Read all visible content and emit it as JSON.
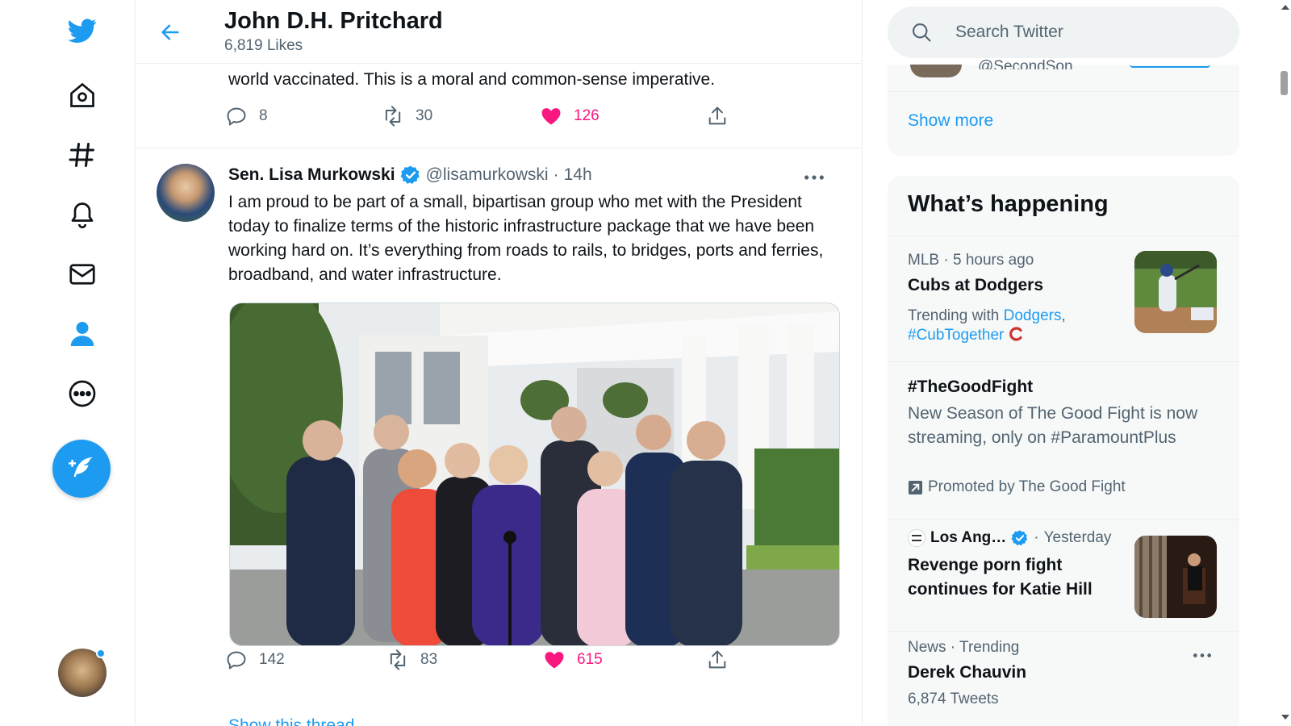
{
  "profile": {
    "title": "John D.H. Pritchard",
    "subtitle": "6,819 Likes"
  },
  "tweet1": {
    "text_tail": "world vaccinated. This is a moral and common-sense imperative.",
    "replies": "8",
    "retweets": "30",
    "likes": "126"
  },
  "tweet2": {
    "name": "Sen. Lisa Murkowski",
    "handle": "@lisamurkowski",
    "separator": "·",
    "time": "14h",
    "text": "I am proud to be part of a small, bipartisan group who met with the President today to finalize terms of the historic infrastructure package that we have been working hard on. It’s everything from roads to rails, to bridges, ports and ferries, broadband, and water infrastructure.",
    "replies": "142",
    "retweets": "83",
    "likes": "615",
    "show_thread": "Show this thread"
  },
  "search": {
    "placeholder": "Search Twitter"
  },
  "who_to_follow": {
    "partial_handle": "@SecondSon",
    "show_more": "Show more"
  },
  "trends": {
    "title": "What’s happening",
    "items": [
      {
        "meta_category": "MLB",
        "meta_sep": "·",
        "meta_time": "5 hours ago",
        "title": "Cubs at Dodgers",
        "trending_with_label": "Trending with",
        "link1": "Dodgers",
        "comma": ",",
        "link2": "#CubTogether"
      },
      {
        "title": "#TheGoodFight",
        "description": "New Season of The Good Fight is now streaming, only on #ParamountPlus",
        "promoted": "Promoted by The Good Fight"
      },
      {
        "source": "Los Ang…",
        "meta_sep": "·",
        "meta_time": "Yesterday",
        "title": "Revenge porn fight continues for Katie Hill"
      },
      {
        "meta": "News · Trending",
        "title": "Derek Chauvin",
        "count": "6,874 Tweets"
      }
    ]
  },
  "icons": {
    "nav": [
      "twitter-logo-icon",
      "home-icon",
      "explore-hashtag-icon",
      "notifications-bell-icon",
      "messages-envelope-icon",
      "profile-person-icon",
      "more-circle-icon"
    ],
    "compose": "compose-feather-icon"
  },
  "colors": {
    "accent": "#1d9bf0",
    "like": "#f91880",
    "secondary_text": "#536471",
    "panel_bg": "#f7f9f9",
    "mlb_cubs_red": "#cc3433"
  }
}
